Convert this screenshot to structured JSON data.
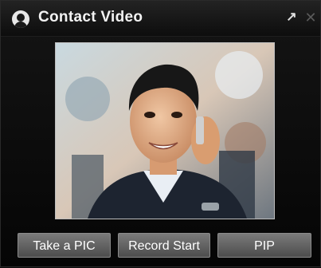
{
  "window": {
    "title": "Contact Video",
    "expand_icon": "expand-arrow-icon",
    "close_icon": "close-icon"
  },
  "video": {
    "subject": "contact-video-feed"
  },
  "buttons": {
    "take_pic": "Take a PIC",
    "record_start": "Record Start",
    "pip": "PIP"
  }
}
